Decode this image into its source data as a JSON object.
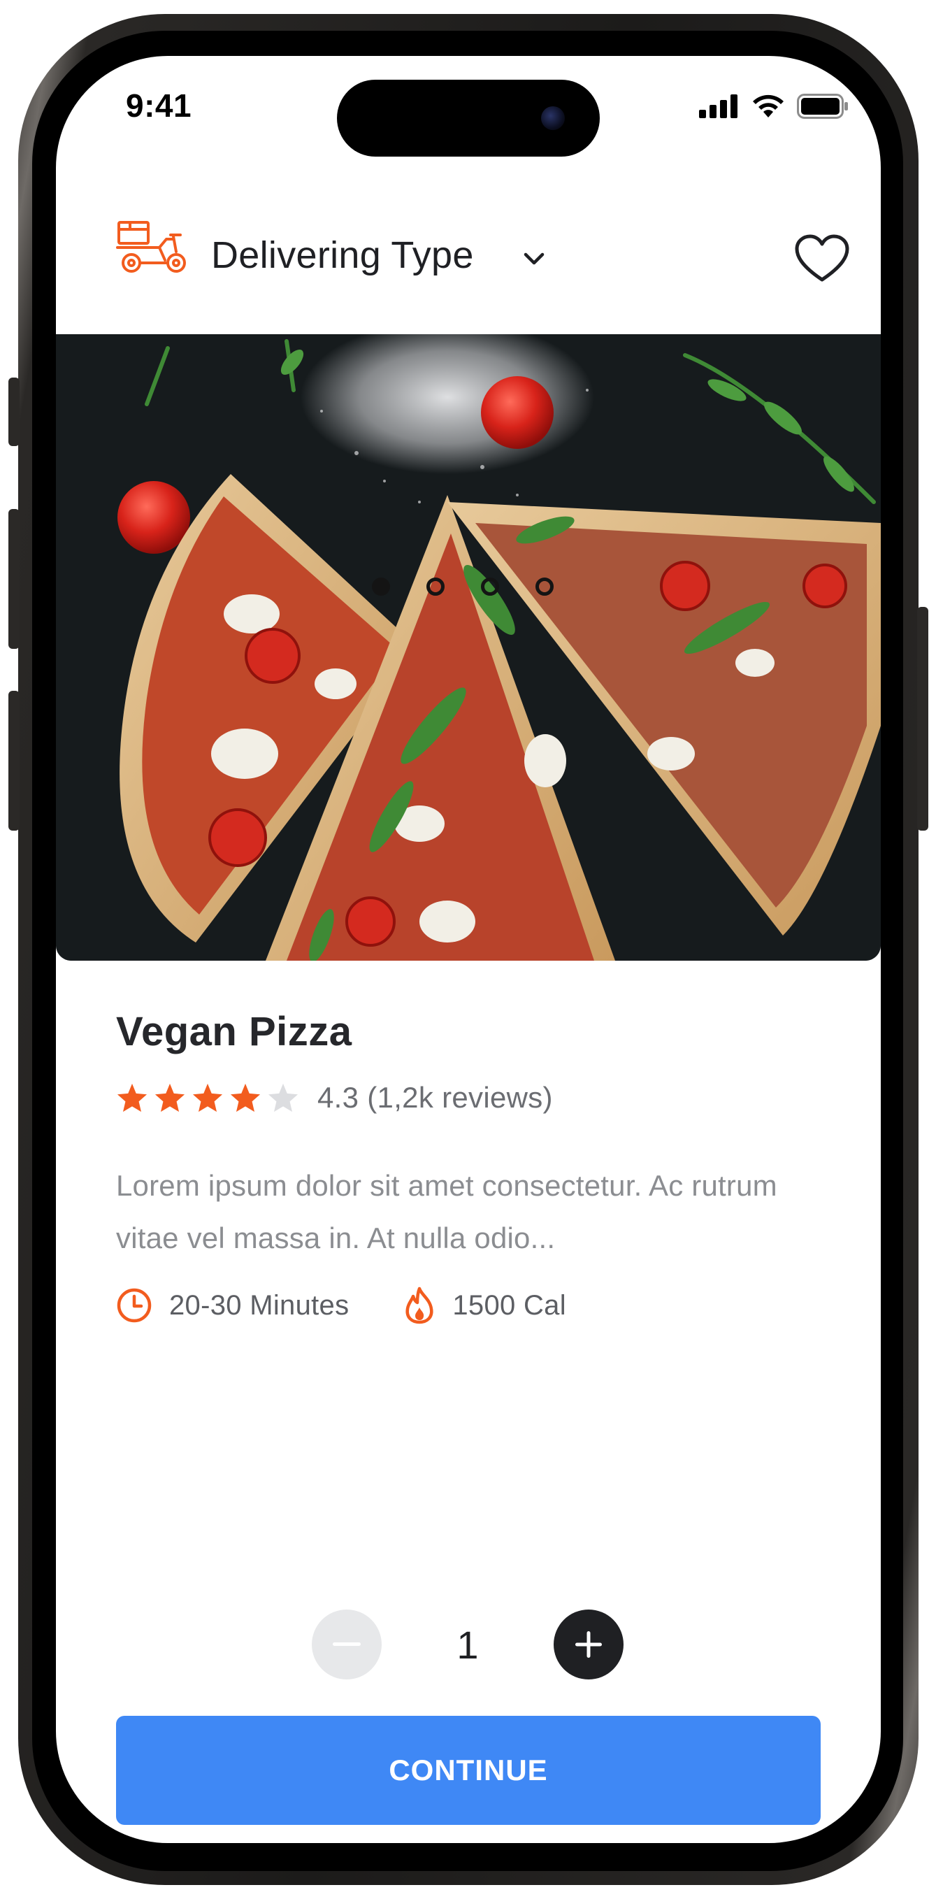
{
  "status_bar": {
    "time": "9:41"
  },
  "header": {
    "title": "Delivering Type",
    "accent_color": "#f25c1e"
  },
  "hero": {
    "image_alt": "pizza-photo",
    "carousel": {
      "count": 4,
      "active_index": 0
    }
  },
  "product": {
    "name": "Vegan Pizza",
    "rating": {
      "filled_stars": 4,
      "max_stars": 5,
      "text": "4.3 (1,2k reviews)"
    },
    "description": "Lorem ipsum dolor sit amet consectetur. Ac rutrum vitae vel massa in. At nulla odio...",
    "time": "20-30 Minutes",
    "calories": "1500 Cal"
  },
  "quantity": {
    "value": "1"
  },
  "cta": {
    "label": "CONTINUE",
    "color": "#3f88f5"
  },
  "colors": {
    "accent": "#f25c1e",
    "star_empty": "#dcdde0",
    "dark": "#1f2023"
  }
}
